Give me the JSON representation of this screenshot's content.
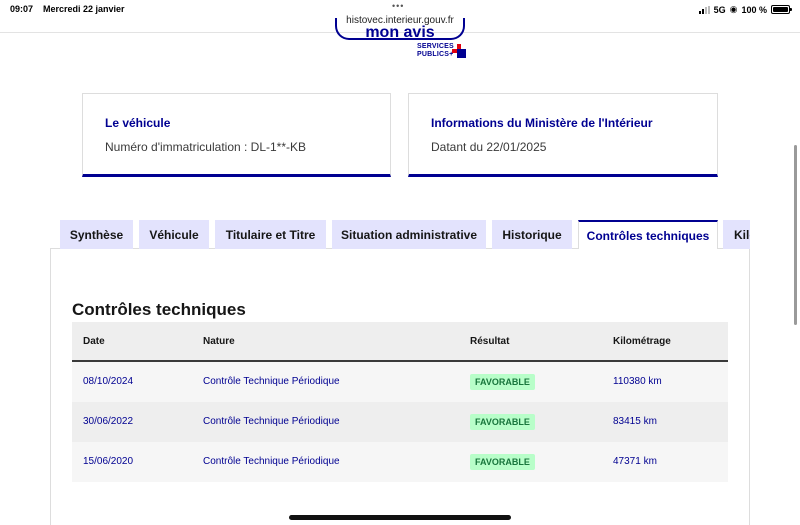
{
  "status_bar": {
    "time": "09:07",
    "date": "Mercredi 22 janvier",
    "dots": "•••",
    "url": "histovec.interieur.gouv.fr",
    "network": "5G",
    "battery": "100 %"
  },
  "header": {
    "mon_avis_label": "mon avis",
    "services_publics_line1": "SERVICES",
    "services_publics_line2": "PUBLICS+",
    "brand_colors": {
      "blue": "#000091",
      "red": "#e1000f"
    }
  },
  "cards": {
    "vehicle": {
      "title": "Le véhicule",
      "text": "Numéro d'immatriculation : DL-1**-KB"
    },
    "ministry": {
      "title": "Informations du Ministère de l'Intérieur",
      "text": "Datant du 22/01/2025"
    }
  },
  "tabs": [
    {
      "label": "Synthèse",
      "active": false
    },
    {
      "label": "Véhicule",
      "active": false
    },
    {
      "label": "Titulaire et Titre",
      "active": false
    },
    {
      "label": "Situation administrative",
      "active": false
    },
    {
      "label": "Historique",
      "active": false
    },
    {
      "label": "Contrôles techniques",
      "active": true
    },
    {
      "label": "Kilométrage",
      "active": false
    }
  ],
  "section": {
    "title": "Contrôles techniques",
    "columns": [
      "Date",
      "Nature",
      "Résultat",
      "Kilométrage"
    ],
    "rows": [
      {
        "date": "08/10/2024",
        "nature": "Contrôle Technique Périodique",
        "result": "FAVORABLE",
        "km": "110380 km"
      },
      {
        "date": "30/06/2022",
        "nature": "Contrôle Technique Périodique",
        "result": "FAVORABLE",
        "km": "83415 km"
      },
      {
        "date": "15/06/2020",
        "nature": "Contrôle Technique Périodique",
        "result": "FAVORABLE",
        "km": "47371 km"
      }
    ]
  },
  "colors": {
    "accent": "#000091",
    "tab_inactive": "#e3e3fd",
    "badge_bg": "#b8fec9",
    "badge_text": "#18753c"
  }
}
